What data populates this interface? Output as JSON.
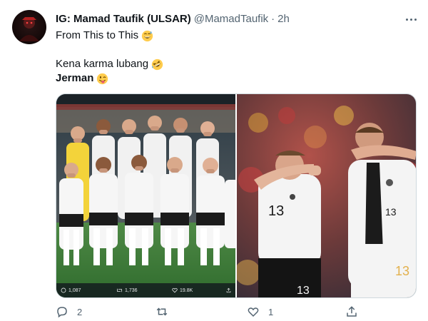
{
  "tweet": {
    "display_name": "IG: Mamad Taufik (ULSAR)",
    "handle": "@MamadTaufik",
    "separator": "·",
    "time": "2h",
    "lines": {
      "line1": "From This to This",
      "line2": "Kena karma lubang",
      "line3": "Jerman"
    },
    "emojis": [
      "grinning-sweat-emoji",
      "rolling-laughing-emoji",
      "winking-tongue-emoji"
    ]
  },
  "media": {
    "left_image_alt_icons": [
      "comment-icon",
      "retweet-icon",
      "like-icon",
      "share-icon"
    ],
    "embedded_stats": {
      "replies": "1,087",
      "retweets": "1,736",
      "likes": "19.8K"
    },
    "jersey_numbers_right": [
      "13",
      "13"
    ]
  },
  "actions": {
    "reply_count": "2",
    "retweet_count": "",
    "like_count": "1",
    "icons": [
      "reply-icon",
      "retweet-icon",
      "like-icon",
      "share-icon"
    ]
  },
  "colors": {
    "text": "#0f1419",
    "muted": "#536471",
    "border": "#cfd9de",
    "pitch_green": "#3f7f3a",
    "goalkeeper_yellow": "#f4d03f"
  }
}
